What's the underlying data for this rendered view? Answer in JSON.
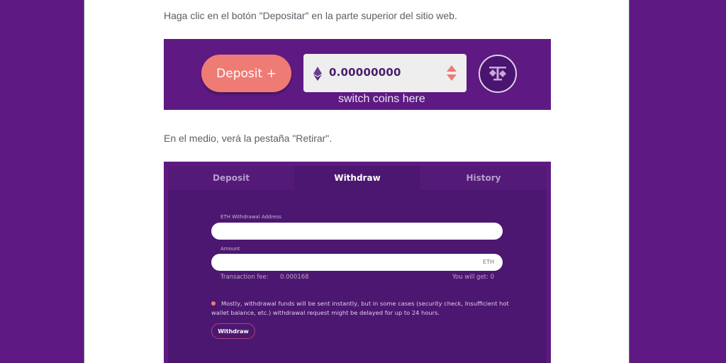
{
  "article": {
    "step1_text": "Haga clic en el botón \"Depositar\" en la parte superior del sitio web.",
    "step2_text": "En el medio, verá la pestaña \"Retirar\"."
  },
  "deposit_banner": {
    "deposit_button_label": "Deposit +",
    "coin_icon": "ethereum-icon",
    "balance": "0.00000000",
    "switch_icon": "up-down-arrows-icon",
    "caption": "switch coins here",
    "fairness_icon": "scale-icon"
  },
  "withdraw_panel": {
    "tabs": [
      {
        "label": "Deposit",
        "active": false
      },
      {
        "label": "Withdraw",
        "active": true
      },
      {
        "label": "History",
        "active": false
      }
    ],
    "address_label": "ETH Withdrawal Address",
    "address_value": "",
    "amount_label": "Amount",
    "amount_value": "",
    "amount_suffix": "ETH",
    "fee_label": "Transaction fee:",
    "fee_value": "0.000168",
    "you_will_get": "You will get: 0",
    "notice": "Mostly, withdrawal funds will be sent instantly, but in some cases (security check, Insufficient hot wallet balance, etc.) withdrawal request might be delayed for up to 24 hours.",
    "withdraw_button_label": "Withdraw"
  },
  "colors": {
    "background_purple": "#5e1a82",
    "accent_coral": "#ef7b75",
    "panel_dark": "#4c1770"
  }
}
